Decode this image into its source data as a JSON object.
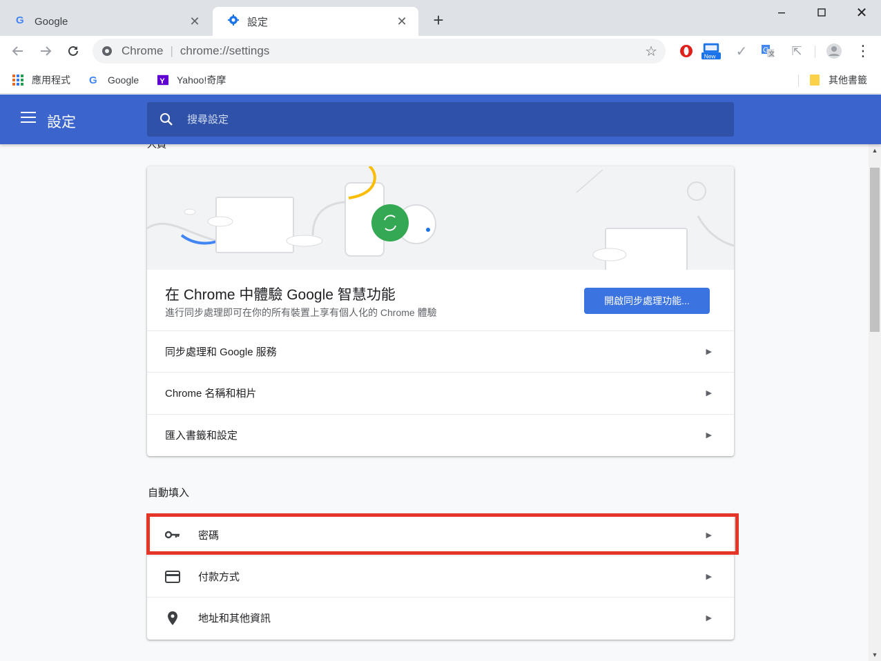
{
  "tabs": [
    {
      "title": "Google",
      "icon": "google-g-icon",
      "close": "✕"
    },
    {
      "title": "設定",
      "icon": "gear-icon",
      "close": "✕"
    }
  ],
  "new_tab": "+",
  "window_controls": {
    "minimize": "—",
    "maximize": "☐",
    "close": "✕"
  },
  "toolbar": {
    "origin": "Chrome",
    "separator": "|",
    "url": "chrome://settings",
    "extensions": [
      "opera-icon",
      "new-badge-icon",
      "check-icon",
      "translate-icon",
      "cursor-icon"
    ],
    "new_badge": "New"
  },
  "bookmarks": {
    "apps": "應用程式",
    "google": "Google",
    "yahoo": "Yahoo!奇摩",
    "other": "其他書籤"
  },
  "settings": {
    "title": "設定",
    "search_placeholder": "搜尋設定",
    "people_section": "人員",
    "promo_title": "在 Chrome 中體驗 Google 智慧功能",
    "promo_subtitle": "進行同步處理即可在你的所有裝置上享有個人化的 Chrome 體驗",
    "sync_button": "開啟同步處理功能...",
    "people_rows": [
      "同步處理和 Google 服務",
      "Chrome 名稱和相片",
      "匯入書籤和設定"
    ],
    "autofill_section": "自動填入",
    "autofill_rows": [
      {
        "label": "密碼",
        "icon": "key-icon"
      },
      {
        "label": "付款方式",
        "icon": "credit-card-icon"
      },
      {
        "label": "地址和其他資訊",
        "icon": "location-pin-icon"
      }
    ],
    "arrow": "▶"
  },
  "colors": {
    "header_blue": "#3b65cc",
    "search_blue": "#2f52a8",
    "button_blue": "#3b73e0",
    "highlight_red": "#e53529",
    "sync_green": "#34a853",
    "accent_yellow": "#fbbc04"
  }
}
